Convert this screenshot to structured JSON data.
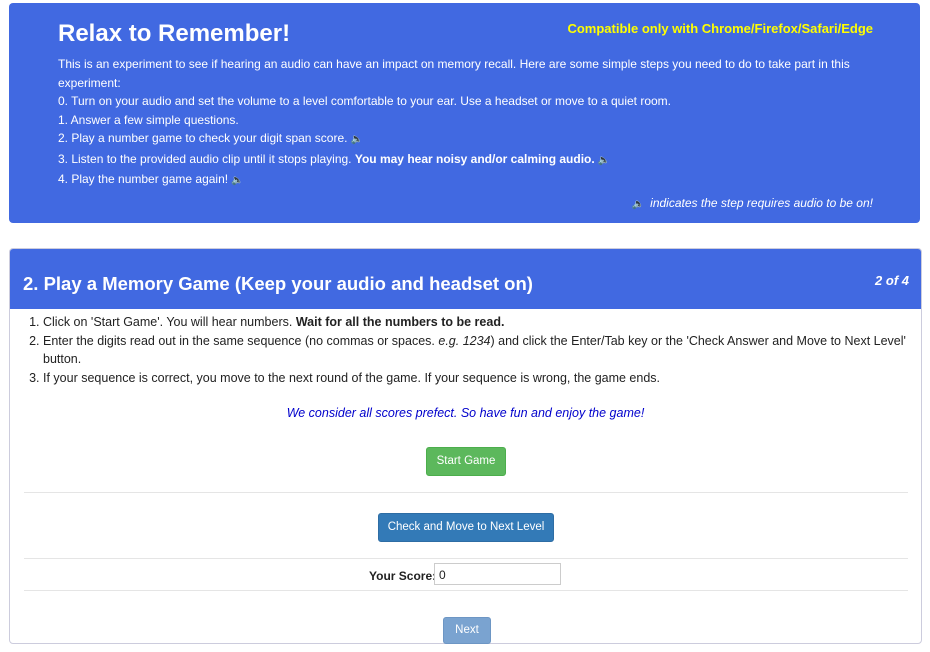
{
  "hero": {
    "title": "Relax to Remember!",
    "compat": "Compatible only with Chrome/Firefox/Safari/Edge",
    "intro": "This is an experiment to see if hearing an audio can have an impact on memory recall. Here are some simple steps you need to do to take part in this experiment:",
    "step0": "0. Turn on your audio and set the volume to a level comfortable to your ear. Use a headset or move to a quiet room.",
    "step1": "1. Answer a few simple questions.",
    "step2": "2. Play a number game to check your digit span score.",
    "step3_text": "3. Listen to the provided audio clip until it stops playing.",
    "step3_bold": "You may hear noisy and/or calming audio.",
    "step4": "4. Play the number game again!",
    "audio_note": "indicates the step requires audio to be on!",
    "speaker_glyph": "🔈"
  },
  "panel": {
    "title": "2. Play a Memory Game (Keep your audio and headset on)",
    "step_count": "2 of 4",
    "instr1_text": "Click on 'Start Game'. You will hear numbers.",
    "instr1_bold": "Wait for all the numbers to be read.",
    "instr2_a": "Enter the digits read out in the same sequence (no commas or spaces.",
    "instr2_em": "e.g. 1234",
    "instr2_b": ") and click the Enter/Tab key or the 'Check Answer and Move to Next Level' button.",
    "instr3": "If your sequence is correct, you move to the next round of the game. If your sequence is wrong, the game ends.",
    "note": "We consider all scores prefect. So have fun and enjoy the game!",
    "start_label": "Start Game",
    "check_label": "Check and Move to Next Level",
    "score_label": "Your Score:",
    "score_value": "0",
    "next_label": "Next"
  },
  "colors": {
    "brand_blue": "#4169e1",
    "compat_yellow": "#ffff00",
    "start_green": "#5cb85c",
    "check_blue": "#337ab7",
    "next_blue": "#7aa3d0",
    "note_blue": "#0000cc"
  },
  "icons": {
    "speaker": "speaker-icon"
  }
}
